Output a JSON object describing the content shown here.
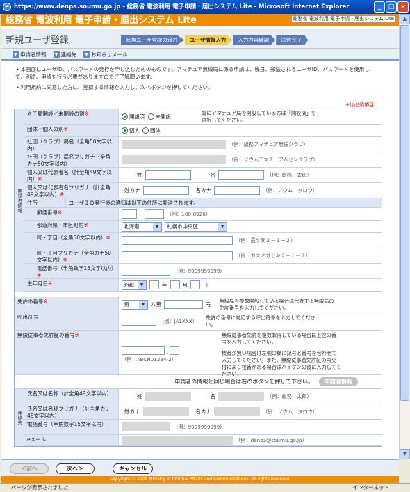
{
  "window": {
    "title": "https://www.denpa.soumu.go.jp - 総務省 電波利用 電子申請・届出システム Lite - Microsoft Internet Explorer"
  },
  "banner": {
    "title": "総務省 電波利用 電子申請・届出システム Lite",
    "subtitle": "総務省 電波利用 電子申請・届出システム Lite"
  },
  "header": {
    "page_title": "新規ユーザ登録",
    "steps": [
      "新規ユーザ登録の流れ",
      "ユーザ情報入力",
      "入力内容確認",
      "送信完了"
    ]
  },
  "quicknav": [
    "申請者情報",
    "連絡先",
    "お知らせメール"
  ],
  "intro": [
    "・本画面はユーザID、パスワードの発行を申し込むためのものです。アマチュア無線局に係る申請は、後日、郵送されるユーザID、パスワードを使用して、別途、申請を行う必要がありますのでご了解願います。",
    "・利用規約に同意した方は、登録する情報を入力し、次へボタンを押してください。"
  ],
  "required_note": "※は必須項目",
  "side_applicant": "申請者情報",
  "side_contact": "連絡先",
  "applicant": {
    "at_label": "ＡＴ局開設／未開設の別",
    "at_opts": [
      "開設済",
      "未開設"
    ],
    "at_note": "既にアマチュア局を開設している方は「開設済」を選択してください。",
    "type_label": "団体・個人の別",
    "type_opts": [
      "個人",
      "団体"
    ],
    "club_name_label": "社団（クラブ）局名（全角50文字以内）",
    "club_name_hint": "（例：総務アマチュア無線クラブ）",
    "club_kana_label": "社団（クラブ）局名フリガナ（全角カナ50文字以内）",
    "club_kana_hint": "（例：ソウムアマチュアムセンクラブ）",
    "name_label": "個人又は代表者名（計全角49文字以内）",
    "sei": "姓",
    "mei": "名",
    "name_hint": "（例：総務　太郎）",
    "kana_label": "個人又は代表者名フリガナ（計全角49文字以内）",
    "sei_kana": "姓カナ",
    "mei_kana": "名カナ",
    "kana_hint": "（例：ソウム　タロウ）",
    "address_label": "住所",
    "address_note": "ユーザＩＤ発行後の通知は以下の住所に郵送されます。",
    "zip_label": "郵便番号",
    "zip_hint": "（例：100-8926）",
    "pref_label": "都道府県・市区町村",
    "pref_value": "北海道",
    "city_value": "札幌市中央区",
    "town_label": "町・丁目（全角50文字以内）",
    "town_hint": "（例：霞ケ関２－１－２）",
    "town_kana_label": "町・丁目フリガナ（全角カナ50文字以内）",
    "town_kana_hint": "（例：カスミガセキ２－１－２）",
    "phone_label": "電話番号（半角数字15文字以内）",
    "phone_hint": "（例：9999999999）",
    "birth_label": "生年月日",
    "era": "昭和",
    "year": "年",
    "month": "月",
    "day": "日",
    "license_label": "免許の番号",
    "license_sel": "関",
    "license_mid": "Ａ第",
    "license_end": "号",
    "license_note": "無線局を複数開設している場合は代表する無線局の免許番号を入力してください。",
    "callsign_label": "呼出符号",
    "callsign_hint": "（例：JA1XXX）",
    "callsign_note": "免許の番号に対応する呼出符号を入力してください。",
    "operator_label": "無線従事者免許証の番号",
    "operator_hint": "（例：ABCN01234-2）",
    "operator_note1": "無線従事者免許を複数取得している場合は上位の番号を入力してください。",
    "operator_note2": "枝番が無い場合は左側の欄に記号と番号を合わせて入力してください。また、無線従事者免許証の再交付により枝番がある場合はハイフンの後に入力してください。"
  },
  "same_note": "申請者の情報と同じ場合は右のボタンを押して下さい。",
  "appinfo_btn": "申請者情報",
  "contact": {
    "name_label": "氏名又は名称（計全角49文字以内）",
    "sei": "姓",
    "mei": "名",
    "name_hint": "（例：総務　太郎）",
    "kana_label": "氏名又は名称フリガナ（計全角カナ49文字以内）",
    "sei_kana": "姓カナ",
    "mei_kana": "名カナ",
    "kana_hint": "（例：ソウム　タロウ）",
    "phone_label": "電話番号（半角数字15文字以内）",
    "phone_hint": "（例：9999999999）",
    "email_label": "eメール",
    "email_hint": "（例：denpa@soumu.go.jp）"
  },
  "nav": {
    "prev": "＜前へ",
    "next": "次へ＞",
    "cancel": "キャンセル"
  },
  "copyright": "Copyright © 2008 Ministry of Internal Affairs and Communications. All rights reserved.",
  "status": {
    "text": "ページが表示されました",
    "zone": "インターネット"
  }
}
